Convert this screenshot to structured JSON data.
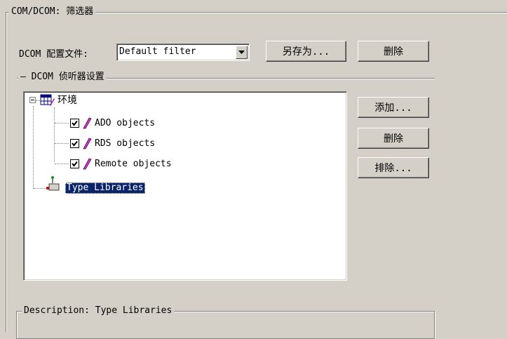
{
  "filter_group": {
    "legend": "COM/DCOM: 筛选器",
    "config_label": "DCOM 配置文件:",
    "config_value": "Default filter",
    "save_as_label": "另存为...",
    "delete_label": "删除"
  },
  "listener_group": {
    "legend": "DCOM 侦听器设置",
    "add_label": "添加...",
    "delete_label": "删除",
    "exclude_label": "排除..."
  },
  "tree": {
    "root_label": "环境",
    "items": [
      {
        "label": "ADO objects",
        "checked": true
      },
      {
        "label": "RDS objects",
        "checked": true
      },
      {
        "label": "Remote objects",
        "checked": true
      }
    ],
    "selected_label": "Type Libraries"
  },
  "description": {
    "legend": "Description: Type Libraries"
  }
}
